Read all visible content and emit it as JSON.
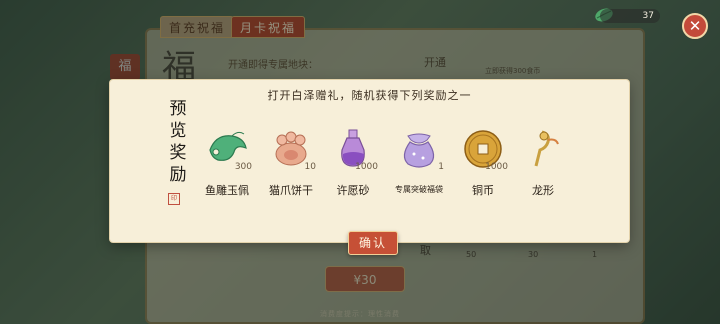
{
  "tabs": [
    {
      "label": "首充祝福"
    },
    {
      "label": "月卡祝福"
    }
  ],
  "background": {
    "fu_char": "福",
    "fu_side": "福",
    "open_text": "开通即得专属地块：",
    "kai_label": "开通",
    "open_right": "立即获得300食币",
    "price_button": "¥30",
    "footer_note": "消费度提示：理性消费",
    "qu_label": "取",
    "bg_qty1": "50",
    "bg_qty2": "30",
    "bg_qty3": "1"
  },
  "currency": {
    "value": "37"
  },
  "dialog": {
    "title": "打开白泽赠礼，随机获得下列奖励之一",
    "side_title": "预览奖励",
    "confirm_label": "确认",
    "items": [
      {
        "name": "鱼雕玉佩",
        "qty": "300",
        "icon": "jade-fish-pendant-icon"
      },
      {
        "name": "猫爪饼干",
        "qty": "10",
        "icon": "cat-paw-cookie-icon"
      },
      {
        "name": "许愿砂",
        "qty": "1000",
        "icon": "wish-sand-bottle-icon"
      },
      {
        "name": "专属突破福袋",
        "qty": "1",
        "icon": "lucky-bag-icon"
      },
      {
        "name": "铜币",
        "qty": "1000",
        "icon": "copper-coin-icon"
      },
      {
        "name": "龙形",
        "qty": "",
        "icon": "dragon-ornament-icon"
      }
    ]
  },
  "colors": {
    "accent": "#c65036",
    "paper": "#f7efd9",
    "gold": "#d8b36b"
  }
}
